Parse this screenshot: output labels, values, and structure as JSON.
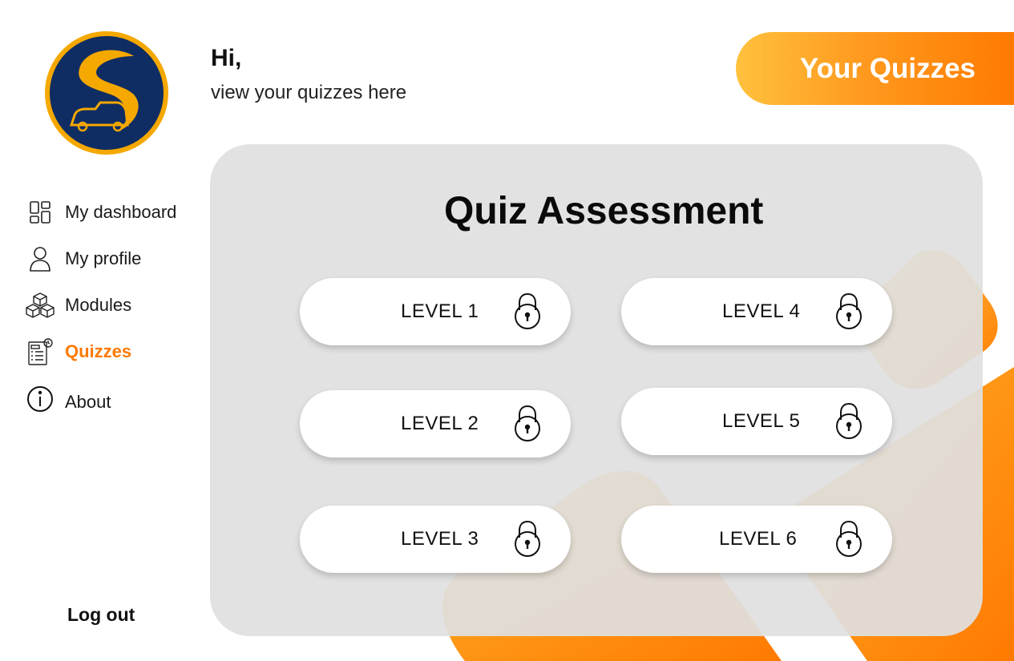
{
  "greeting": {
    "title": "Hi,",
    "subtitle": "view your quizzes here"
  },
  "header": {
    "label": "Your Quizzes",
    "gradient_start": "#ffc13d",
    "gradient_end": "#ff7a00"
  },
  "sidebar": {
    "items": [
      {
        "label": "My dashboard",
        "icon": "dashboard-icon",
        "active": false
      },
      {
        "label": "My profile",
        "icon": "user-icon",
        "active": false
      },
      {
        "label": "Modules",
        "icon": "cubes-icon",
        "active": false
      },
      {
        "label": "Quizzes",
        "icon": "quiz-icon",
        "active": true
      },
      {
        "label": "About",
        "icon": "info-icon",
        "active": false
      }
    ],
    "logout_label": "Log out",
    "active_color": "#ff7a00"
  },
  "main": {
    "title": "Quiz Assessment",
    "levels": [
      {
        "label": "LEVEL 1",
        "icon": "lock-icon",
        "locked": true
      },
      {
        "label": "LEVEL 2",
        "icon": "lock-icon",
        "locked": true
      },
      {
        "label": "LEVEL 3",
        "icon": "lock-icon",
        "locked": true
      },
      {
        "label": "LEVEL 4",
        "icon": "lock-icon",
        "locked": true
      },
      {
        "label": "LEVEL 5",
        "icon": "lock-icon",
        "locked": true
      },
      {
        "label": "LEVEL 6",
        "icon": "lock-icon",
        "locked": true
      }
    ]
  },
  "logo": {
    "icon": "road-car-logo",
    "ring_color": "#f5a800",
    "fill_color": "#0f2d63"
  }
}
